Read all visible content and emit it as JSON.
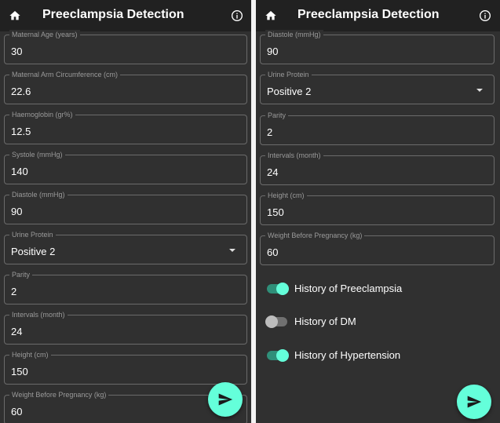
{
  "colors": {
    "appbar": "#212121",
    "background": "#303030",
    "accent": "#64ffda",
    "text": "#ffffff",
    "label": "#9a9a9a"
  },
  "icons": {
    "home": "home-icon",
    "info": "info-icon",
    "send": "send-icon",
    "dropdown": "dropdown-arrow-icon"
  },
  "left": {
    "title": "Preeclampsia Detection",
    "fields": [
      {
        "label": "Maternal Age (years)",
        "value": "30"
      },
      {
        "label": "Maternal Arm Circumference (cm)",
        "value": "22.6"
      },
      {
        "label": "Haemoglobin (gr%)",
        "value": "12.5"
      },
      {
        "label": "Systole (mmHg)",
        "value": "140"
      },
      {
        "label": "Diastole (mmHg)",
        "value": "90"
      },
      {
        "label": "Urine Protein",
        "value": "Positive 2"
      },
      {
        "label": "Parity",
        "value": "2"
      },
      {
        "label": "Intervals (month)",
        "value": "24"
      },
      {
        "label": "Height (cm)",
        "value": "150"
      },
      {
        "label": "Weight Before Pregnancy (kg)",
        "value": "60"
      }
    ]
  },
  "right": {
    "title": "Preeclampsia Detection",
    "fields": [
      {
        "label": "Diastole (mmHg)",
        "value": "90"
      },
      {
        "label": "Urine Protein",
        "value": "Positive 2"
      },
      {
        "label": "Parity",
        "value": "2"
      },
      {
        "label": "Intervals (month)",
        "value": "24"
      },
      {
        "label": "Height (cm)",
        "value": "150"
      },
      {
        "label": "Weight Before Pregnancy (kg)",
        "value": "60"
      }
    ],
    "toggles": [
      {
        "label": "History of Preeclampsia",
        "on": true
      },
      {
        "label": "History of DM",
        "on": false
      },
      {
        "label": "History of Hypertension",
        "on": true
      }
    ]
  }
}
